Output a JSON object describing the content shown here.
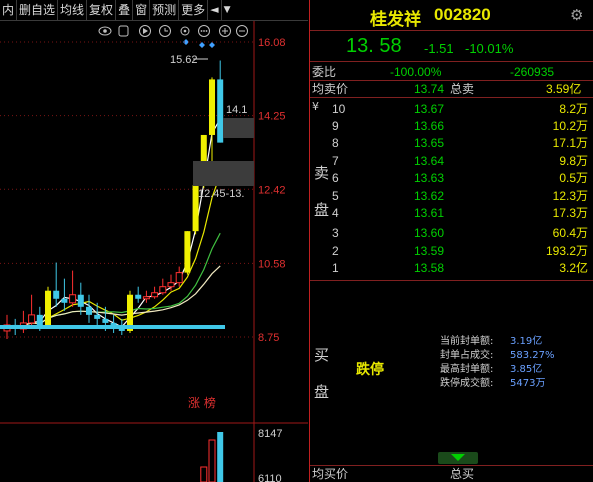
{
  "toolbar": {
    "items": [
      "内",
      "删自选",
      "均线",
      "复权",
      "叠",
      "窗",
      "预测",
      "更多"
    ]
  },
  "chart": {
    "price_labels": [
      "16.08",
      "14.25",
      "12.42",
      "10.58",
      "8.75"
    ],
    "vol_labels": [
      "8147",
      "6110"
    ],
    "high_label": "15.62",
    "right_label": "14.1",
    "gap_label": "12.45-13.",
    "tag": "涨 榜"
  },
  "chart_data": {
    "type": "candlestick",
    "price_axis_ticks": [
      16.08,
      14.25,
      12.42,
      10.58,
      8.75
    ],
    "volume_axis_ticks": [
      8147,
      6110
    ],
    "candles": [
      {
        "open": 8.9,
        "close": 9.05,
        "high": 9.3,
        "low": 8.7
      },
      {
        "open": 9.05,
        "close": 8.95,
        "high": 9.2,
        "low": 8.8
      },
      {
        "open": 8.95,
        "close": 9.1,
        "high": 9.4,
        "low": 8.85
      },
      {
        "open": 9.1,
        "close": 9.3,
        "high": 9.8,
        "low": 9.0
      },
      {
        "open": 9.3,
        "close": 9.0,
        "high": 9.5,
        "low": 8.9
      },
      {
        "open": 9.0,
        "close": 9.9,
        "high": 10.0,
        "low": 8.95
      },
      {
        "open": 9.9,
        "close": 9.7,
        "high": 10.6,
        "low": 9.5
      },
      {
        "open": 9.7,
        "close": 9.6,
        "high": 10.2,
        "low": 9.4
      },
      {
        "open": 9.6,
        "close": 9.8,
        "high": 10.4,
        "low": 9.5
      },
      {
        "open": 9.8,
        "close": 9.5,
        "high": 10.1,
        "low": 9.3
      },
      {
        "open": 9.5,
        "close": 9.3,
        "high": 9.8,
        "low": 9.1
      },
      {
        "open": 9.3,
        "close": 9.2,
        "high": 9.6,
        "low": 9.0
      },
      {
        "open": 9.2,
        "close": 9.1,
        "high": 9.5,
        "low": 8.9
      },
      {
        "open": 9.1,
        "close": 9.0,
        "high": 9.3,
        "low": 8.85
      },
      {
        "open": 9.0,
        "close": 8.9,
        "high": 9.2,
        "low": 8.8
      },
      {
        "open": 8.9,
        "close": 9.8,
        "high": 9.9,
        "low": 8.85
      },
      {
        "open": 9.8,
        "close": 9.7,
        "high": 10.0,
        "low": 9.6
      },
      {
        "open": 9.7,
        "close": 9.75,
        "high": 9.9,
        "low": 9.6
      },
      {
        "open": 9.75,
        "close": 9.85,
        "high": 10.0,
        "low": 9.7
      },
      {
        "open": 9.85,
        "close": 10.0,
        "high": 10.2,
        "low": 9.8
      },
      {
        "open": 10.0,
        "close": 10.1,
        "high": 10.3,
        "low": 9.9
      },
      {
        "open": 10.1,
        "close": 10.35,
        "high": 10.5,
        "low": 10.0
      },
      {
        "open": 10.35,
        "close": 11.38,
        "high": 11.38,
        "low": 10.3
      },
      {
        "open": 11.38,
        "close": 12.52,
        "high": 12.52,
        "low": 11.3
      },
      {
        "open": 12.52,
        "close": 13.77,
        "high": 13.77,
        "low": 12.45
      },
      {
        "open": 13.77,
        "close": 15.15,
        "high": 15.2,
        "low": 13.1
      },
      {
        "open": 15.15,
        "close": 13.58,
        "high": 15.62,
        "low": 13.58
      }
    ]
  },
  "panel": {
    "stock_name": "桂发祥",
    "stock_code": "002820",
    "price": "13. 58",
    "change": "-1.51",
    "change_pct": "-10.01%",
    "weibi_label": "委比",
    "weibi_pct": "-100.00%",
    "weibi_val": "-260935",
    "avg_sell_label": "均卖价",
    "avg_sell_price": "13.74",
    "total_sell_label": "总卖",
    "total_sell": "3.59亿",
    "sell_side_label_top": "卖",
    "sell_side_label_bottom": "盘",
    "buy_side_label_top": "买",
    "buy_side_label_bottom": "盘",
    "yen": "¥",
    "sell_levels": [
      {
        "lvl": "10",
        "price": "13.67",
        "vol": "8.2万"
      },
      {
        "lvl": "9",
        "price": "13.66",
        "vol": "10.2万"
      },
      {
        "lvl": "8",
        "price": "13.65",
        "vol": "17.1万"
      },
      {
        "lvl": "7",
        "price": "13.64",
        "vol": "9.8万"
      },
      {
        "lvl": "6",
        "price": "13.63",
        "vol": "0.5万"
      },
      {
        "lvl": "5",
        "price": "13.62",
        "vol": "12.3万"
      },
      {
        "lvl": "4",
        "price": "13.61",
        "vol": "17.3万"
      },
      {
        "lvl": "3",
        "price": "13.60",
        "vol": "60.4万"
      },
      {
        "lvl": "2",
        "price": "13.59",
        "vol": "193.2万"
      },
      {
        "lvl": "1",
        "price": "13.58",
        "vol": "3.2亿"
      }
    ],
    "limit_status": "跌停",
    "stats": [
      {
        "label": "当前封单额:",
        "value": "3.19亿"
      },
      {
        "label": "封单占成交:",
        "value": "583.27%"
      },
      {
        "label": "最高封单额:",
        "value": "3.85亿"
      },
      {
        "label": "跌停成交额:",
        "value": "5473万"
      }
    ],
    "avg_buy_label": "均买价",
    "total_buy_label": "总买"
  }
}
